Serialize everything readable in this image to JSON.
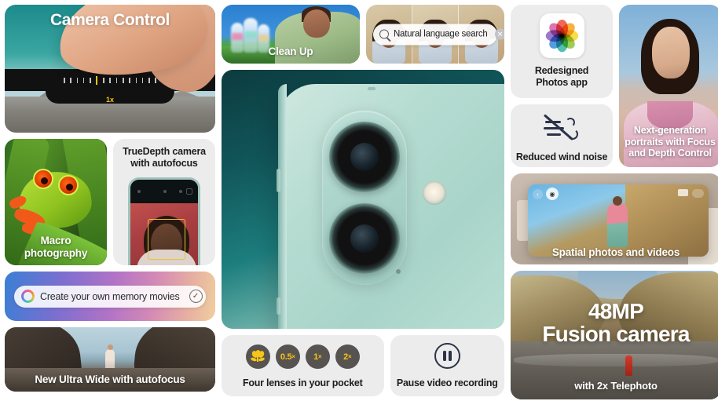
{
  "tiles": {
    "camera_control": {
      "title": "Camera Control",
      "zoom_label": "1x",
      "icon": "finger-press-icon"
    },
    "macro": {
      "caption": "Macro photography"
    },
    "truedepth": {
      "heading_line1": "TrueDepth camera",
      "heading_line2": "with autofocus"
    },
    "memory_movies": {
      "field_value": "Create your own memory movies",
      "ai_icon": "apple-intelligence-ring-icon",
      "confirm_icon": "checkmark-circle-icon"
    },
    "ultra_wide": {
      "caption": "New Ultra Wide with autofocus"
    },
    "clean_up": {
      "caption": "Clean Up"
    },
    "search": {
      "value": "Natural language search",
      "search_icon": "search-icon",
      "clear_icon": "clear-circle-icon",
      "clear_glyph": "✕"
    },
    "hero": {
      "alt": "iPhone rear dual-camera in teal"
    },
    "lenses": {
      "caption": "Four lenses in your pocket",
      "buttons": [
        {
          "label": "",
          "icon": "macro-flower-icon"
        },
        {
          "label": "0.5",
          "suffix": "×"
        },
        {
          "label": "1",
          "suffix": "×"
        },
        {
          "label": "2",
          "suffix": "×"
        }
      ]
    },
    "pause": {
      "caption": "Pause video recording",
      "icon": "pause-icon"
    },
    "photos_app": {
      "label_line1": "Redesigned",
      "label_line2": "Photos app",
      "icon": "photos-app-icon",
      "petal_colors": [
        "#f0533f",
        "#f5a623",
        "#f7d832",
        "#8ec63f",
        "#3bb6a6",
        "#3d8fd6",
        "#8a66c4",
        "#d95fa4"
      ]
    },
    "wind_noise": {
      "label": "Reduced wind noise",
      "icon": "wind-slash-icon"
    },
    "portrait": {
      "caption_line1": "Next-generation",
      "caption_line2": "portraits with Focus",
      "caption_line3": "and Depth Control"
    },
    "spatial": {
      "caption": "Spatial photos and videos",
      "back_icon": "chevron-left-icon",
      "menu_icon": "more-circle-icon"
    },
    "fusion": {
      "line1": "48MP",
      "line2": "Fusion camera",
      "subtitle": "with 2x Telephoto"
    }
  },
  "colors": {
    "tile_background": "#ececec",
    "page_background": "#ffffff",
    "text_primary": "#1d1d1f",
    "accent_yellow": "#f5c518",
    "accent_blue": "#2a7bdd",
    "lens_button": "#575350",
    "pause_stroke": "#2b3348"
  }
}
